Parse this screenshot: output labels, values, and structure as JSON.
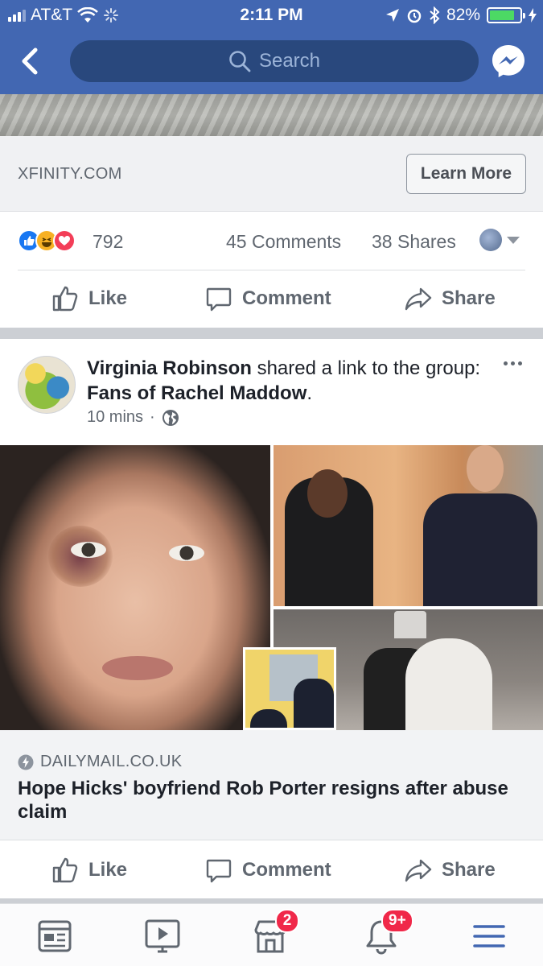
{
  "status_bar": {
    "carrier": "AT&T",
    "time": "2:11 PM",
    "battery_percent": "82%",
    "battery_level": 0.82
  },
  "nav": {
    "search_placeholder": "Search",
    "icons": [
      "back-chevron-icon",
      "search-icon",
      "messenger-icon"
    ]
  },
  "ad": {
    "domain": "XFINITY.COM",
    "cta_label": "Learn More"
  },
  "post1_stats": {
    "reactions_count": "792",
    "comments": "45 Comments",
    "shares": "38 Shares"
  },
  "actions": {
    "like": "Like",
    "comment": "Comment",
    "share": "Share"
  },
  "post2": {
    "author": "Virginia Robinson",
    "verb": "shared a link to the group:",
    "group": "Fans of Rachel Maddow",
    "time": "10 mins",
    "link": {
      "domain": "DAILYMAIL.CO.UK",
      "title": "Hope Hicks' boyfriend Rob Porter resigns after abuse claim"
    }
  },
  "tabbar": {
    "items": [
      "news-feed",
      "watch",
      "marketplace",
      "notifications",
      "menu"
    ],
    "marketplace_badge": "2",
    "notifications_badge": "9+"
  },
  "colors": {
    "brand_blue": "#4267b2",
    "search_bg": "#29487d",
    "tab_active": "#4267b2",
    "badge_red": "#f02849"
  }
}
